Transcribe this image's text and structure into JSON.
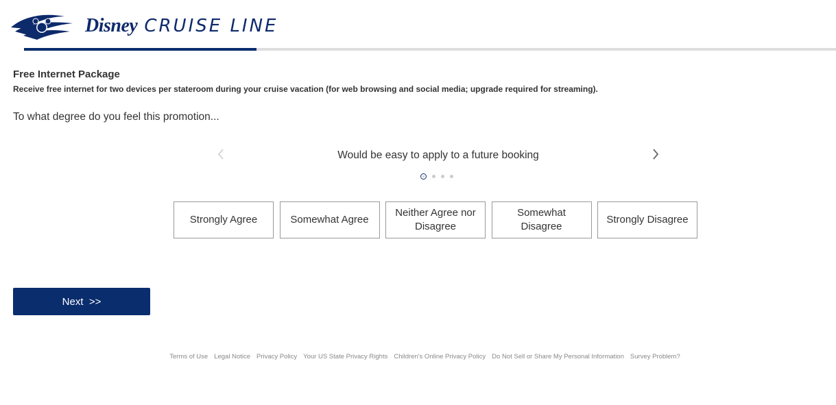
{
  "header": {
    "brand_disney": "Disney",
    "brand_line": "CRUISE LINE"
  },
  "progress": {
    "fraction": 0.286
  },
  "section": {
    "title": "Free Internet Package",
    "description": "Receive free internet for two devices per stateroom during your cruise vacation (for web browsing and social media; upgrade required for streaming)."
  },
  "question": "To what degree do you feel this promotion...",
  "carousel": {
    "statement": "Would be easy to apply to a future booking",
    "total_slides": 4,
    "current_slide": 1
  },
  "options": [
    "Strongly Agree",
    "Somewhat Agree",
    "Neither Agree nor Disagree",
    "Somewhat Disagree",
    "Strongly Disagree"
  ],
  "next_button": {
    "label": "Next",
    "arrows": ">>"
  },
  "footer": {
    "links": [
      "Terms of Use",
      "Legal Notice",
      "Privacy Policy",
      "Your US State Privacy Rights",
      "Children's Online Privacy Policy",
      "Do Not Sell or Share My Personal Information",
      "Survey Problem?"
    ]
  },
  "colors": {
    "brand_navy": "#0a2d6e",
    "progress_track": "#dddddd",
    "option_border": "#999999",
    "footer_link": "#888888"
  },
  "icons": {
    "logo": "disney-cruise-ship-logo-icon",
    "prev": "chevron-left-icon",
    "next": "chevron-right-icon"
  }
}
